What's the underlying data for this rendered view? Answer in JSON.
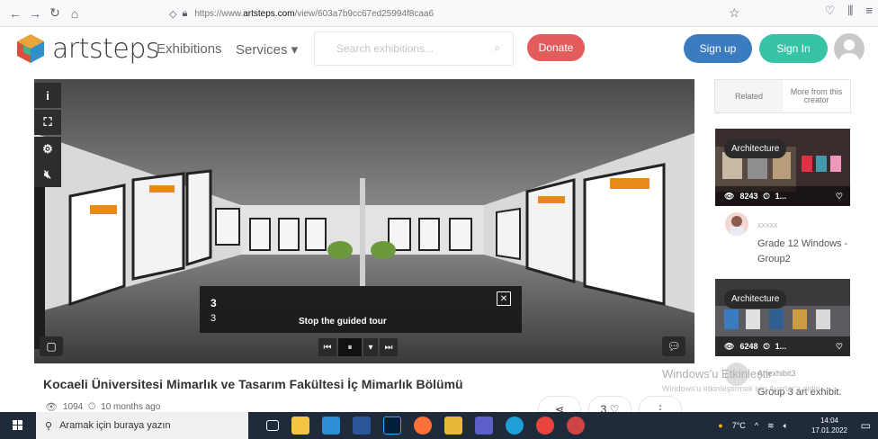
{
  "browser": {
    "url_prefix": "https://www.",
    "url_host": "artsteps.com",
    "url_path": "/view/603a7b9cc67ed25994f8caa6"
  },
  "header": {
    "logo_text": "artsteps",
    "nav_exhibitions": "Exhibitions",
    "nav_services": "Services ▾",
    "search_placeholder": "Search exhibitions...",
    "donate": "Donate",
    "sign_up": "Sign up",
    "sign_in": "Sign In"
  },
  "viewer": {
    "tour_title": "3",
    "tour_subtitle": "3",
    "tour_stop": "Stop the guided tour"
  },
  "exhibition": {
    "title": "Kocaeli Üniversitesi Mimarlık ve Tasarım Fakültesi İç Mimarlık Bölümü",
    "views": "1094",
    "time": "10 months ago",
    "comment_count": "3"
  },
  "sidebar": {
    "tab_related": "Related",
    "tab_more": "More from this creator",
    "cards": [
      {
        "badge": "Architecture",
        "views": "8243",
        "more": "1...",
        "user": "xxxxx",
        "title": "Grade 12 Windows - Group2"
      },
      {
        "badge": "Architecture",
        "views": "6248",
        "more": "1...",
        "user": "Artexhibit3",
        "title": "Group 3 art exhibit."
      }
    ]
  },
  "watermark": {
    "line1": "Windows'u Etkinleştir",
    "line2": "Windows'u etkinleştirmek için Ayarlar'a gidin."
  },
  "taskbar": {
    "search_text": "Aramak için buraya yazın",
    "temp": "7°C",
    "time": "14:04",
    "date": "17.01.2022"
  }
}
